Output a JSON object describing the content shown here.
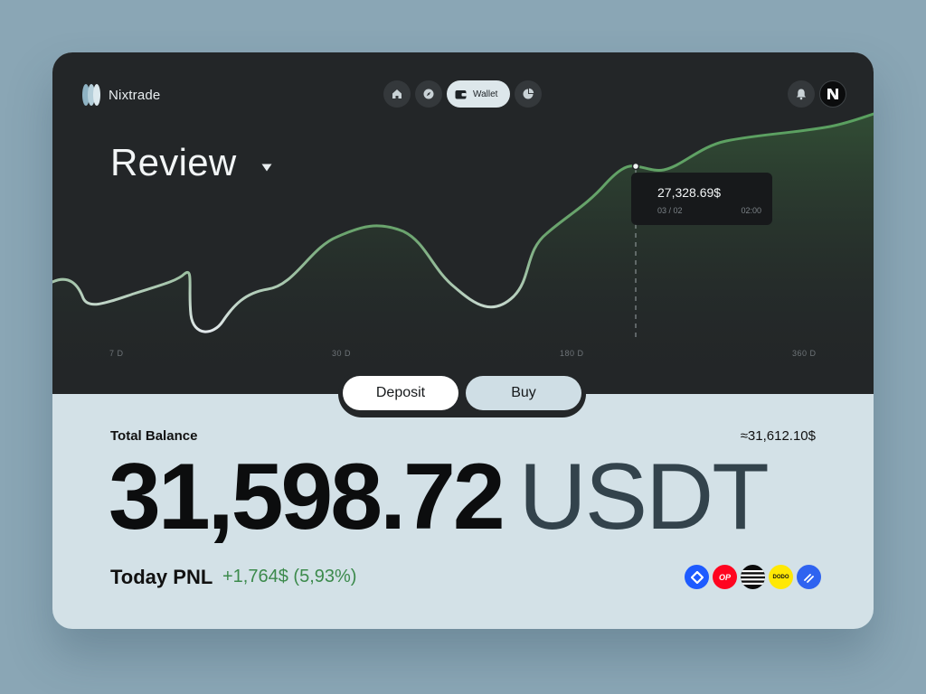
{
  "app": {
    "name": "Nixtrade"
  },
  "nav": {
    "items": [
      {
        "icon": "home-icon"
      },
      {
        "icon": "compass-icon"
      },
      {
        "icon": "wallet-icon",
        "label": "Wallet",
        "active": true
      },
      {
        "icon": "pie-chart-icon"
      }
    ]
  },
  "header_right": {
    "icons": [
      "bell-icon",
      "avatar-n-icon"
    ]
  },
  "review": {
    "title": "Review"
  },
  "tooltip": {
    "value": "27,328.69$",
    "date": "03 / 02",
    "time": "02:00"
  },
  "x_labels": [
    "7 D",
    "30 D",
    "180 D",
    "360 D"
  ],
  "chart_data": {
    "type": "line",
    "x": [
      "7 D",
      "30 D",
      "180 D",
      "360 D"
    ],
    "series": [
      {
        "values": []
      }
    ],
    "highlight": {
      "x": "03 / 02 02:00",
      "value": 27328.69
    },
    "colors": {
      "line_high": "#59A05F",
      "line_low": "#E2E8EB"
    }
  },
  "actions": {
    "deposit": "Deposit",
    "buy": "Buy"
  },
  "balance": {
    "label": "Total Balance",
    "approx": "≈31,612.10$",
    "amount": "31,598.72",
    "currency": "USDT"
  },
  "pnl": {
    "label": "Today PNL",
    "value": "+1,764$ (5,93%)"
  },
  "tokens": [
    {
      "name": "worldcoin-icon"
    },
    {
      "name": "optimism-icon",
      "label": "OP"
    },
    {
      "name": "aevo-icon"
    },
    {
      "name": "dodo-icon",
      "label": "DODO"
    },
    {
      "name": "zksync-icon"
    }
  ],
  "colors": {
    "dark_panel": "#232628",
    "light_panel": "#D3E1E7",
    "positive": "#3C8A4C",
    "background": "#8AA6B5"
  }
}
